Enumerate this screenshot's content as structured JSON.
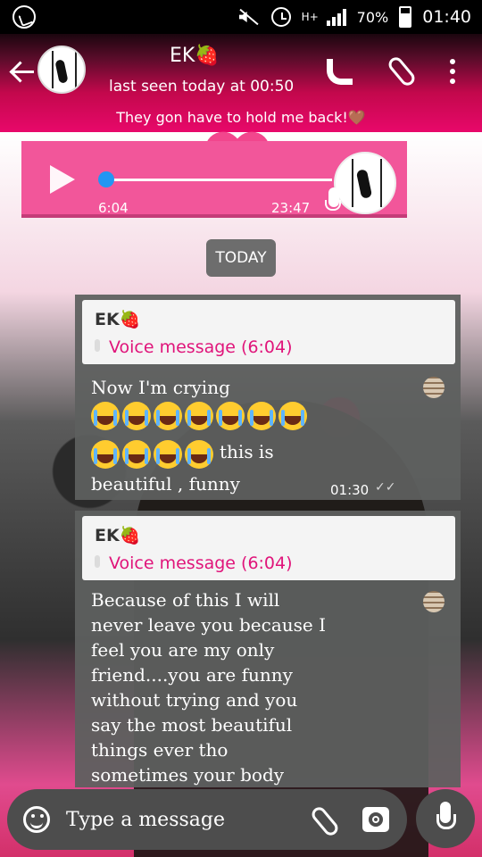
{
  "status_bar": {
    "network": "H+",
    "battery": "70%",
    "time": "01:40",
    "icons": [
      "whatsapp-icon",
      "mute-icon",
      "alarm-icon",
      "signal-icon",
      "battery-charging-icon"
    ]
  },
  "header": {
    "contact_name": "EK🍓",
    "last_seen": "last seen today at 00:50",
    "status_message": "They gon have to hold me back!🤎",
    "icons": [
      "back-arrow-icon",
      "phone-icon",
      "paperclip-icon",
      "more-vert-icon"
    ]
  },
  "voice_message": {
    "elapsed": "6:04",
    "total": "23:47",
    "progress": 0.02,
    "icons": [
      "play-icon",
      "mic-icon"
    ]
  },
  "date_divider": "TODAY",
  "messages": [
    {
      "quote": {
        "name": "EK🍓",
        "text": "Voice message (6:04)"
      },
      "line1": "Now I'm crying",
      "emoji_row1_count": 7,
      "emoji_row2_count": 4,
      "emoji_suffix": "this is",
      "line3": "beautiful , funny",
      "time": "01:30"
    },
    {
      "quote": {
        "name": "EK🍓",
        "text": "Voice message (6:04)"
      },
      "text": "Because of this I will\nnever leave you because I\nfeel you are my only\nfriend....you are funny\nwithout trying and you\nsay the most beautiful\nthings ever tho\nsometimes your body"
    }
  ],
  "composer": {
    "placeholder": "Type a message",
    "icons": [
      "emoji-icon",
      "paperclip-icon",
      "camera-icon",
      "mic-icon"
    ]
  },
  "colors": {
    "accent_pink": "#e8086a",
    "bubble_gray": "#5e605f",
    "quote_pink_text": "#e0147a",
    "progress_blue": "#2196f3"
  }
}
